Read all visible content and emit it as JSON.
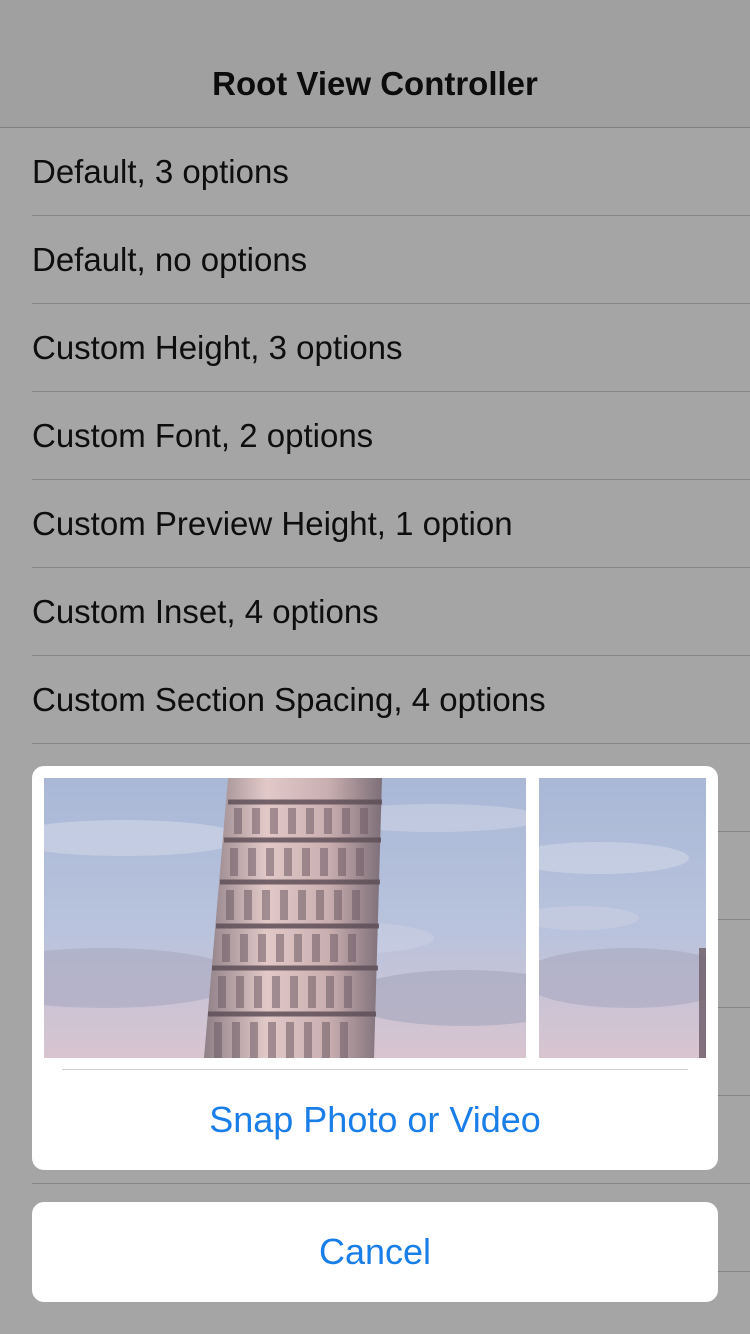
{
  "navbar": {
    "title": "Root View Controller"
  },
  "table": {
    "rows": [
      {
        "label": "Default, 3 options"
      },
      {
        "label": "Default, no options"
      },
      {
        "label": "Custom Height, 3 options"
      },
      {
        "label": "Custom Font, 2 options"
      },
      {
        "label": "Custom Preview Height, 1 option"
      },
      {
        "label": "Custom Inset, 4 options"
      },
      {
        "label": "Custom Section Spacing, 4 options"
      }
    ]
  },
  "action_sheet": {
    "action_label": "Snap Photo or Video",
    "cancel_label": "Cancel",
    "accent_color": "#1a7ee8"
  }
}
